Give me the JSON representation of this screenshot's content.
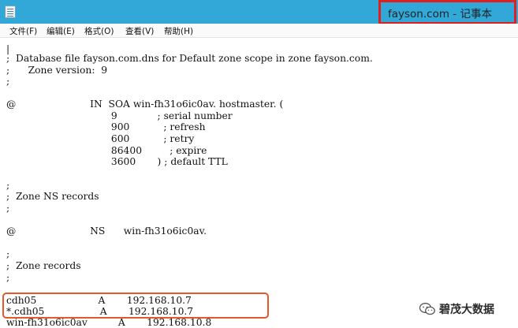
{
  "window": {
    "title": "fayson.com - 记事本"
  },
  "menu": [
    {
      "label": "文件(F)"
    },
    {
      "label": "编辑(E)"
    },
    {
      "label": "格式(O)"
    },
    {
      "label": "查看(V)"
    },
    {
      "label": "帮助(H)"
    }
  ],
  "document": {
    "lines": [
      "|",
      ";  Database file fayson.com.dns for Default zone scope in zone fayson.com.",
      ";      Zone version:  9",
      ";",
      "@                        IN  SOA win-fh31o6ic0av. hostmaster. (",
      "                                  9             ; serial number",
      "                                  900           ; refresh",
      "                                  600           ; retry",
      "                                  86400         ; expire",
      "                                  3600       ) ; default TTL",
      ";",
      ";  Zone NS records",
      ";",
      "@                        NS      win-fh31o6ic0av.",
      ";",
      ";  Zone records",
      ";",
      "cdh05                    A       192.168.10.7",
      "*.cdh05                  A       192.168.10.7",
      "win-fh31o6ic0av          A       192.168.10.8"
    ]
  },
  "watermark": {
    "text": "碧茂大数据",
    "icon": "wechat-icon"
  },
  "colors": {
    "titlebar": "#31a8d8",
    "highlight_title": "#e02020",
    "highlight_records": "#e8562a"
  }
}
